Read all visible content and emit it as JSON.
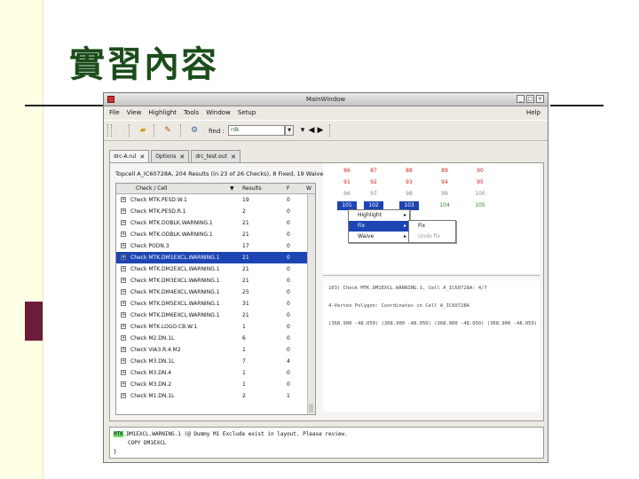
{
  "slide": {
    "title": "實習內容"
  },
  "window": {
    "title": "MainWindow"
  },
  "menu": {
    "items": [
      "File",
      "View",
      "Highlight",
      "Tools",
      "Window",
      "Setup"
    ],
    "help": "Help"
  },
  "toolbar": {
    "find_label": "find :",
    "find_value": "rdk"
  },
  "tabs": [
    {
      "label": "drc-A.rul"
    },
    {
      "label": "Options"
    },
    {
      "label": "drc_test.out"
    }
  ],
  "summary": {
    "text": "Topcell A_IC60728A, 204 Results (in 23 of 26 Checks), 8 Fixed, 19 Waived",
    "btn1": "...",
    "btn2": "<",
    "btn3": ">"
  },
  "tree": {
    "headers": {
      "check": "Check / Cell",
      "results": "Results",
      "f": "F",
      "w": "W"
    },
    "rows": [
      {
        "name": "Check MTK.PESD.W.1",
        "results": "19",
        "f": "0",
        "w": "0"
      },
      {
        "name": "Check MTK.PESD.R.1",
        "results": "2",
        "f": "0",
        "w": "0"
      },
      {
        "name": "Check MTK.DOBLK.WARNING.1",
        "results": "21",
        "f": "0",
        "w": "0"
      },
      {
        "name": "Check MTK.ODBLK.WARNING.1",
        "results": "21",
        "f": "0",
        "w": "0"
      },
      {
        "name": "Check PODN.3",
        "results": "17",
        "f": "0",
        "w": "0"
      },
      {
        "name": "Check MTK.DM1EXCL.WARNING.1",
        "results": "21",
        "f": "0",
        "w": "0"
      },
      {
        "name": "Check MTK.DM2EXCL.WARNING.1",
        "results": "21",
        "f": "0",
        "w": "0"
      },
      {
        "name": "Check MTK.DM3EXCL.WARNING.1",
        "results": "21",
        "f": "0",
        "w": "0"
      },
      {
        "name": "Check MTK.DM4EXCL.WARNING.1",
        "results": "25",
        "f": "0",
        "w": "0"
      },
      {
        "name": "Check MTK.DM5EXCL.WARNING.1",
        "results": "31",
        "f": "0",
        "w": "0"
      },
      {
        "name": "Check MTK.DM6EXCL.WARNING.1",
        "results": "21",
        "f": "0",
        "w": "0"
      },
      {
        "name": "Check MTK.LOGO.CB.W.1",
        "results": "1",
        "f": "0",
        "w": "0"
      },
      {
        "name": "Check M2.DN.1L",
        "results": "6",
        "f": "0",
        "w": "0"
      },
      {
        "name": "Check VIA3.R.4.M2",
        "results": "1",
        "f": "0",
        "w": "0"
      },
      {
        "name": "Check M3.DN.1L",
        "results": "7",
        "f": "4",
        "w": "0"
      },
      {
        "name": "Check M3.DN.4",
        "results": "1",
        "f": "0",
        "w": "0"
      },
      {
        "name": "Check M3.DN.2",
        "results": "1",
        "f": "0",
        "w": "0"
      },
      {
        "name": "Check M1.DN.1L",
        "results": "2",
        "f": "1",
        "w": "0"
      }
    ]
  },
  "grid": {
    "rows": [
      [
        "86",
        "87",
        "88",
        "89",
        "90"
      ],
      [
        "91",
        "92",
        "93",
        "94",
        "95"
      ],
      [
        "96",
        "97",
        "98",
        "99",
        "100"
      ],
      [
        "101",
        "102",
        "103",
        "104",
        "105"
      ]
    ]
  },
  "context_menu": {
    "items": [
      "Highlight",
      "Fix",
      "Waive"
    ],
    "submenu": [
      "Fix",
      "Undo fix"
    ]
  },
  "log": {
    "line1": "103) Check MTK.DM1EXCL.WARNING.1, Cell A_IC60728A: 4/7",
    "line2": "4-Vertex Polygon: Coordinates in Cell A_IC60728A",
    "line3": "(368.900  -48.050)  (368.900  -48.050)  (368.900  -48.050)  (368.900  -48.050)"
  },
  "bottom": {
    "line1_hl": "MTK",
    "line1": ".DM1EXCL.WARNING.1 (@ Dummy M1 Exclude exist in layout. Please review.",
    "line2": "COPY DM1EXCL",
    "line3": "}"
  }
}
